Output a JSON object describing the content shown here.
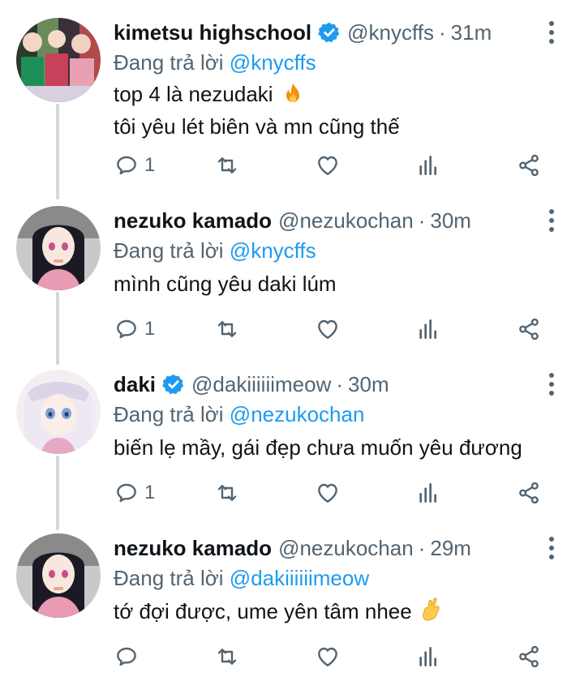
{
  "colors": {
    "text": "#0f1419",
    "secondary": "#536471",
    "accent": "#1d9bf0",
    "thread_line": "#cfd9de"
  },
  "tweets": [
    {
      "name": "kimetsu highschool",
      "verified": true,
      "handle": "@knycffs",
      "separator": "·",
      "time": "31m",
      "reply_prefix": "Đang trả lời",
      "reply_to": "@knycffs",
      "lines": [
        "top 4 là nezudaki",
        "tôi yêu lét biên và mn cũng thế"
      ],
      "emoji_icon": "fire-emoji",
      "reply_count": "1",
      "avatar_icon": "collage-avatar"
    },
    {
      "name": "nezuko kamado",
      "verified": false,
      "handle": "@nezukochan",
      "separator": "·",
      "time": "30m",
      "reply_prefix": "Đang trả lời",
      "reply_to": "@knycffs",
      "lines": [
        "mình cũng yêu daki lúm"
      ],
      "reply_count": "1",
      "avatar_icon": "nezuko-avatar"
    },
    {
      "name": "daki",
      "verified": true,
      "handle": "@dakiiiiiimeow",
      "separator": "·",
      "time": "30m",
      "reply_prefix": "Đang trả lời",
      "reply_to": "@nezukochan",
      "lines": [
        "biến lẹ mầy, gái đẹp chưa muốn yêu đương"
      ],
      "reply_count": "1",
      "avatar_icon": "daki-avatar"
    },
    {
      "name": "nezuko kamado",
      "verified": false,
      "handle": "@nezukochan",
      "separator": "·",
      "time": "29m",
      "reply_prefix": "Đang trả lời",
      "reply_to": "@dakiiiiiimeow",
      "lines": [
        "tớ đợi được, ume yên tâm nhee"
      ],
      "emoji_icon": "crossed-fingers-emoji",
      "reply_count": "",
      "avatar_icon": "nezuko-avatar"
    }
  ]
}
